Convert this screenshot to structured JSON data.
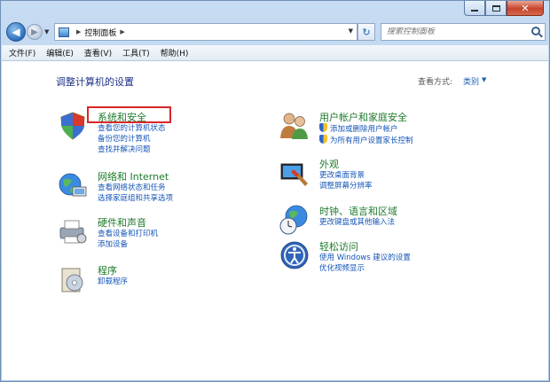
{
  "window": {
    "close_glyph": "✕"
  },
  "address": {
    "breadcrumb": "控制面板",
    "search_placeholder": "搜索控制面板"
  },
  "menubar": {
    "items": [
      "文件(F)",
      "编辑(E)",
      "查看(V)",
      "工具(T)",
      "帮助(H)"
    ]
  },
  "main": {
    "title": "调整计算机的设置",
    "view_by_label": "查看方式:",
    "view_by_value": "类别"
  },
  "categories": {
    "left": [
      {
        "title": "系统和安全",
        "icon": "shield-icon",
        "links": [
          "查看您的计算机状态",
          "备份您的计算机",
          "查找并解决问题"
        ]
      },
      {
        "title": "网络和 Internet",
        "icon": "network-globe-icon",
        "links": [
          "查看网络状态和任务",
          "选择家庭组和共享选项"
        ]
      },
      {
        "title": "硬件和声音",
        "icon": "printer-icon",
        "links": [
          "查看设备和打印机",
          "添加设备"
        ]
      },
      {
        "title": "程序",
        "icon": "programs-icon",
        "links": [
          "卸载程序"
        ]
      }
    ],
    "right": [
      {
        "title": "用户帐户和家庭安全",
        "icon": "users-icon",
        "links": [
          "添加或删除用户帐户",
          "为所有用户设置家长控制"
        ]
      },
      {
        "title": "外观",
        "icon": "appearance-icon",
        "links": [
          "更改桌面背景",
          "调整屏幕分辨率"
        ]
      },
      {
        "title": "时钟、语言和区域",
        "icon": "clock-globe-icon",
        "links": [
          "更改键盘或其他输入法"
        ]
      },
      {
        "title": "轻松访问",
        "icon": "accessibility-icon",
        "links": [
          "使用 Windows 建议的设置",
          "优化视频显示"
        ]
      }
    ]
  }
}
